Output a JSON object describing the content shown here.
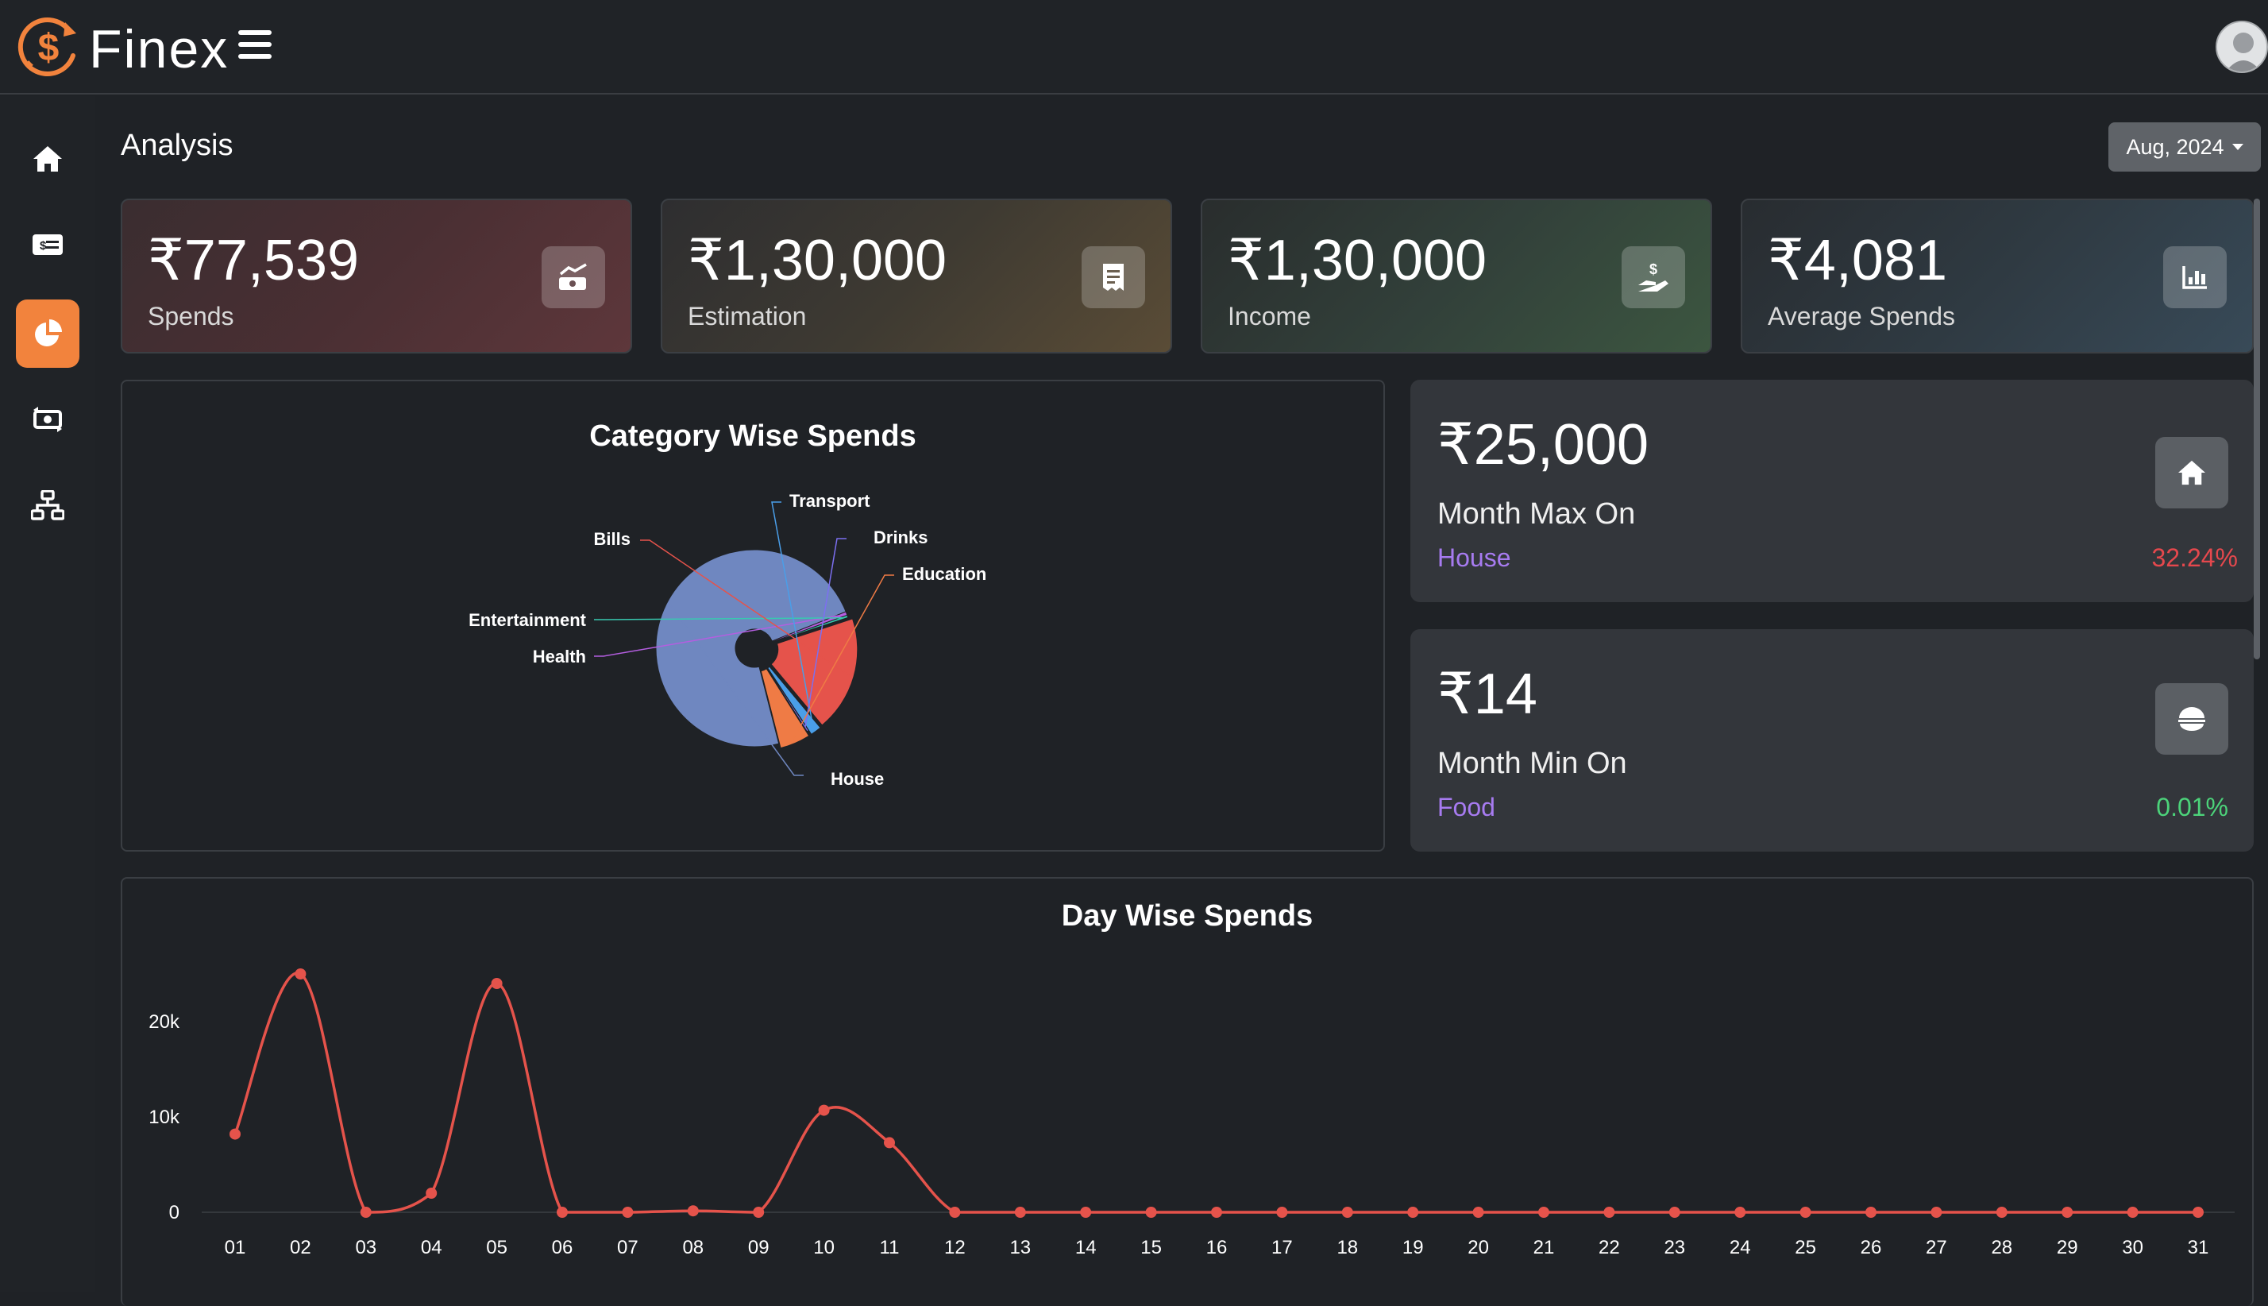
{
  "app": {
    "brand": "Finex"
  },
  "page": {
    "title": "Analysis",
    "month_select": "Aug, 2024"
  },
  "colors": {
    "accent": "#f2833d",
    "line": "#e5534b",
    "house": "#6f87c0",
    "bills": "#e5534b",
    "education": "#ef7b45",
    "transport": "#4a9ee8",
    "drinks": "#7c6ff0",
    "entertainment": "#38c9b0",
    "health": "#b45ee0",
    "positive": "#4cd37a",
    "negative": "#e5484d"
  },
  "sidebar": {
    "items": [
      {
        "name": "nav-home",
        "icon": "home-icon"
      },
      {
        "name": "nav-transactions",
        "icon": "money-bill-icon"
      },
      {
        "name": "nav-analysis",
        "icon": "pie-chart-icon",
        "active": true
      },
      {
        "name": "nav-exchange",
        "icon": "money-exchange-icon"
      },
      {
        "name": "nav-categories",
        "icon": "sitemap-icon"
      }
    ]
  },
  "stats": [
    {
      "value": "₹77,539",
      "label": "Spends",
      "icon": "money-chart-icon"
    },
    {
      "value": "₹1,30,000",
      "label": "Estimation",
      "icon": "receipt-icon"
    },
    {
      "value": "₹1,30,000",
      "label": "Income",
      "icon": "hand-holding-dollar-icon"
    },
    {
      "value": "₹4,081",
      "label": "Average Spends",
      "icon": "chart-simple-icon"
    }
  ],
  "month_max": {
    "value": "₹25,000",
    "label": "Month Max On",
    "category": "House",
    "percent": "32.24%",
    "icon": "house-icon"
  },
  "month_min": {
    "value": "₹14",
    "label": "Month Min On",
    "category": "Food",
    "percent": "0.01%",
    "icon": "bowl-food-icon"
  },
  "chart_data": [
    {
      "type": "pie",
      "title": "Category Wise Spends",
      "labels": [
        "House",
        "Health",
        "Entertainment",
        "Bills",
        "Transport",
        "Drinks",
        "Education"
      ],
      "values": [
        73,
        0.6,
        0.4,
        19,
        1.8,
        0.3,
        5
      ],
      "label_positions": [
        "bottom-right",
        "left",
        "left",
        "top-left",
        "top",
        "top-right",
        "right"
      ]
    },
    {
      "type": "line",
      "title": "Day Wise Spends",
      "x": [
        "01",
        "02",
        "03",
        "04",
        "05",
        "06",
        "07",
        "08",
        "09",
        "10",
        "11",
        "12",
        "13",
        "14",
        "15",
        "16",
        "17",
        "18",
        "19",
        "20",
        "21",
        "22",
        "23",
        "24",
        "25",
        "26",
        "27",
        "28",
        "29",
        "30",
        "31"
      ],
      "series": [
        {
          "values": [
            8200,
            25000,
            0,
            2000,
            24000,
            0,
            0,
            150,
            0,
            10700,
            7300,
            0,
            0,
            0,
            0,
            0,
            0,
            0,
            0,
            0,
            0,
            0,
            0,
            0,
            0,
            0,
            0,
            0,
            0,
            0,
            0
          ]
        }
      ],
      "yticks": [
        {
          "value": 0,
          "label": "0"
        },
        {
          "value": 10000,
          "label": "10k"
        },
        {
          "value": 20000,
          "label": "20k"
        }
      ],
      "ylim": [
        0,
        27000
      ],
      "grid": false,
      "smooth": true
    }
  ]
}
